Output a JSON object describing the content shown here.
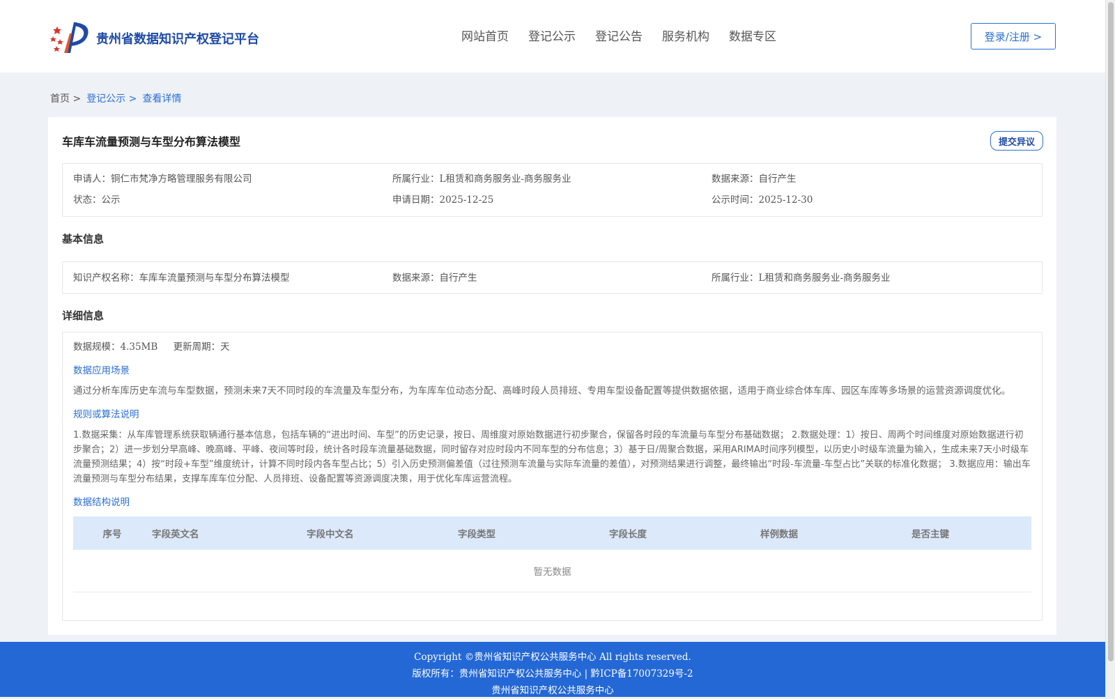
{
  "header": {
    "brand": "贵州省数据知识产权登记平台",
    "nav": [
      "网站首页",
      "登记公示",
      "登记公告",
      "服务机构",
      "数据专区"
    ],
    "login_label": "登录/注册 >"
  },
  "breadcrumb": {
    "home": "首页 >",
    "registry": "登记公示 >",
    "current": "查看详情"
  },
  "record": {
    "title": "车库车流量预测与车型分布算法模型",
    "objection_label": "提交异议",
    "summary": {
      "applicant_label": "申请人：",
      "applicant": "铜仁市梵净方略管理服务有限公司",
      "industry_label": "所属行业：",
      "industry": "L租赁和商务服务业-商务服务业",
      "source_label": "数据来源：",
      "source": "自行产生",
      "status_label": "状态：",
      "status": "公示",
      "apply_date_label": "申请日期：",
      "apply_date": "2025-12-25",
      "publish_date_label": "公示时间：",
      "publish_date": "2025-12-30"
    },
    "basic_heading": "基本信息",
    "basic": {
      "ip_name_label": "知识产权名称：",
      "ip_name": "车库车流量预测与车型分布算法模型",
      "source_label": "数据来源：",
      "source": "自行产生",
      "industry_label": "所属行业：",
      "industry": "L租赁和商务服务业-商务服务业"
    },
    "detail_heading": "详细信息",
    "detail": {
      "scale": "数据规模：4.35MB",
      "cycle": "更新周期：天",
      "scenario_heading": "数据应用场景",
      "scenario_text": "通过分析车库历史车流与车型数据，预测未来7天不同时段的车流量及车型分布，为车库车位动态分配、高峰时段人员排班、专用车型设备配置等提供数据依据，适用于商业综合体车库、园区车库等多场景的运营资源调度优化。",
      "algorithm_heading": "规则或算法说明",
      "algorithm_text": "1.数据采集：从车库管理系统获取辆通行基本信息，包括车辆的“进出时间、车型”的历史记录，按日、周维度对原始数据进行初步聚合，保留各时段的车流量与车型分布基础数据； 2.数据处理：1）按日、周两个时间维度对原始数据进行初步聚合；2）进一步划分早高峰、晚高峰、平峰、夜间等时段，统计各时段车流量基础数据，同时留存对应时段内不同车型的分布信息；3）基于日/周聚合数据，采用ARIMA时间序列模型，以历史小时级车流量为输入，生成未来7天小时级车流量预测结果；4）按“时段+车型”维度统计，计算不同时段内各车型占比；5）引入历史预测偏差值（过往预测车流量与实际车流量的差值），对预测结果进行调整，最终输出“时段-车流量-车型占比”关联的标准化数据； 3.数据应用：输出车流量预测与车型分布结果，支撑车库车位分配、人员排班、设备配置等资源调度决策，用于优化车库运营流程。",
      "structure_heading": "数据结构说明",
      "columns": [
        "序号",
        "字段英文名",
        "字段中文名",
        "字段类型",
        "字段长度",
        "样例数据",
        "是否主键"
      ],
      "empty_text": "暂无数据"
    }
  },
  "footer": {
    "line1": "Copyright ©贵州省知识产权公共服务中心 All rights reserved.",
    "line2": "版权所有：贵州省知识产权公共服务中心 | 黔ICP备17007329号-2",
    "line3": "贵州省知识产权公共服务中心"
  },
  "colors": {
    "accent": "#2a6fd6",
    "brand": "#1e4aa8",
    "footer_bg": "#2468d6",
    "table_header_bg": "#dce9fb"
  }
}
